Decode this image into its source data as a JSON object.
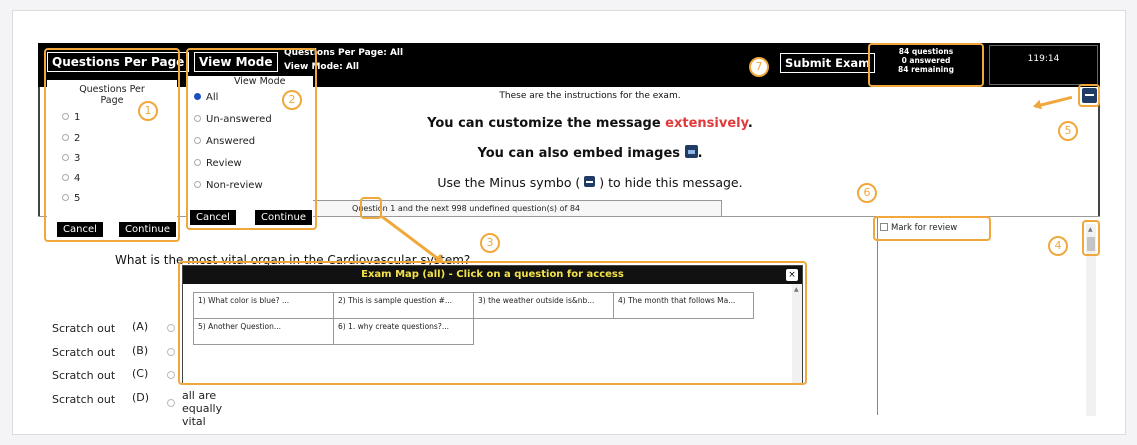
{
  "header": {
    "qpp_button": "Questions Per Page",
    "viewmode_button": "View Mode",
    "qpp_summary": "Questions Per Page: All",
    "viewmode_summary": "View Mode: All",
    "submit_button": "Submit Exam",
    "counts": [
      "84 questions",
      "0 answered",
      "84 remaining"
    ],
    "timer": "119:14"
  },
  "qpp_dropdown": {
    "title": "Questions Per Page",
    "options": [
      "1",
      "2",
      "3",
      "4",
      "5"
    ],
    "cancel": "Cancel",
    "continue": "Continue"
  },
  "viewmode_dropdown": {
    "title": "View Mode",
    "options": [
      "All",
      "Un-answered",
      "Answered",
      "Review",
      "Non-review"
    ],
    "selected": "All",
    "cancel": "Cancel",
    "continue": "Continue"
  },
  "instructions": {
    "line1": "These are the instructions for the exam.",
    "line2_a": "You can customize the message ",
    "line2_b": "extensively",
    "line2_c": ".",
    "line3": "You can also embed images",
    "line4_a": "Use the Minus symbo (",
    "line4_b": ") to hide this message."
  },
  "pager": "Question 1 and the next 998 undefined question(s) of 84",
  "question": {
    "text": "What is the most vital organ in the Cardiovascular system?",
    "answers": [
      {
        "scratch": "Scratch out",
        "letter": "(A)",
        "text": ""
      },
      {
        "scratch": "Scratch out",
        "letter": "(B)",
        "text": ""
      },
      {
        "scratch": "Scratch out",
        "letter": "(C)",
        "text": ""
      },
      {
        "scratch": "Scratch out",
        "letter": "(D)",
        "text": "all are equally vital"
      }
    ]
  },
  "review": "Mark for review",
  "exam_map": {
    "title": "Exam Map (all) - Click on a question for access",
    "close": "×",
    "items": [
      "1) What color is blue? ...",
      "2) This is sample question #...",
      "3) the weather outside is&nb...",
      "4) The month that follows Ma...",
      "5) Another Question...",
      "6) 1. why create questions?..."
    ]
  },
  "callouts": [
    "1",
    "2",
    "3",
    "4",
    "5",
    "6",
    "7"
  ],
  "colors": {
    "highlight": "#f0a83c",
    "title_yellow": "#f3e24a",
    "emphasis_red": "#e03a3a",
    "radio_blue": "#1a4fbf"
  }
}
